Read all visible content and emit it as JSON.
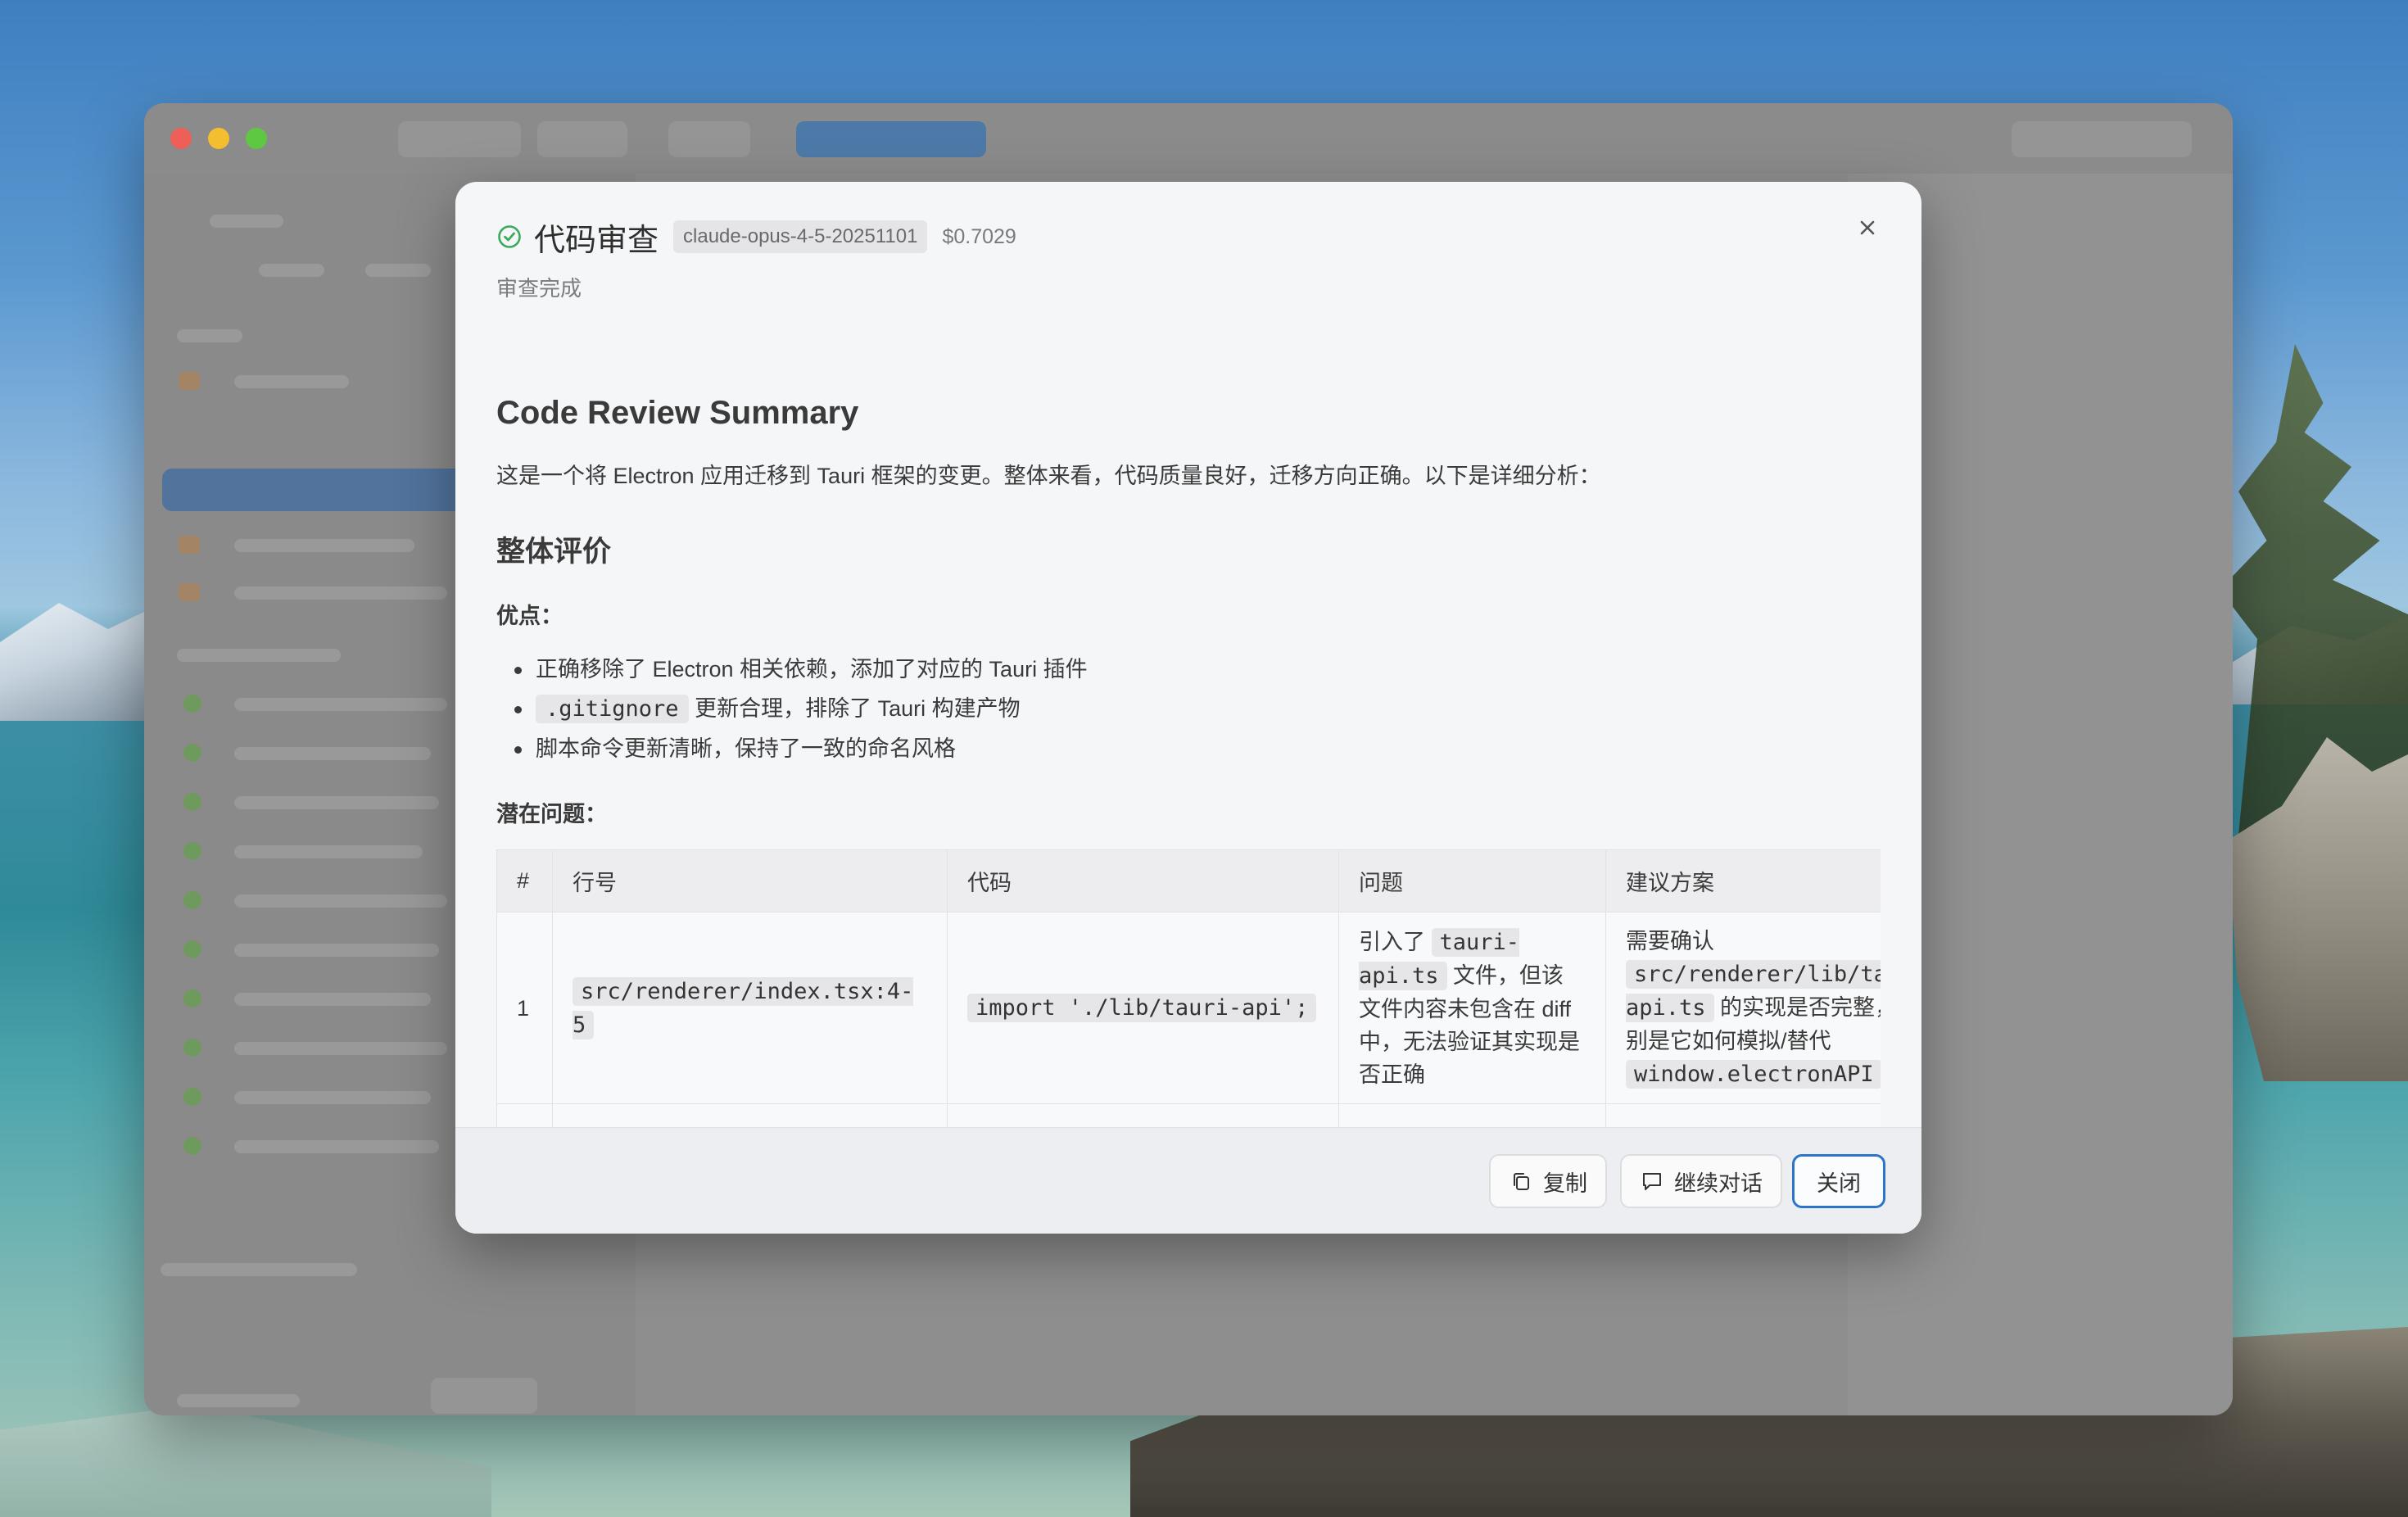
{
  "background": {
    "accent": "#2b74c8"
  },
  "modal": {
    "title": "代码审查",
    "model": "claude-opus-4-5-20251101",
    "cost": "$0.7029",
    "subtitle": "审查完成",
    "status_icon": "check-circle-icon",
    "status_color": "#3bab5b"
  },
  "content": {
    "h1": "Code Review Summary",
    "intro": "这是一个将 Electron 应用迁移到 Tauri 框架的变更。整体来看，代码质量良好，迁移方向正确。以下是详细分析：",
    "overall_heading": "整体评价",
    "pros_heading": "优点：",
    "pros": {
      "item1": "正确移除了 Electron 相关依赖，添加了对应的 Tauri 插件",
      "item2_code": ".gitignore",
      "item2_text": " 更新合理，排除了 Tauri 构建产物",
      "item3": "脚本命令更新清晰，保持了一致的命名风格"
    },
    "issues_heading": "潜在问题：",
    "table": {
      "headers": [
        "#",
        "行号",
        "代码",
        "问题",
        "建议方案"
      ],
      "row1": {
        "index": "1",
        "line": "src/renderer/index.tsx:4-5",
        "code": "import './lib/tauri-api';",
        "issue_prefix": "引入了 ",
        "issue_code": "tauri-api.ts",
        "issue_suffix": " 文件，但该文件内容未包含在 diff 中，无法验证其实现是否正确",
        "fix_prefix": "需要确认 ",
        "fix_code": "src/renderer/lib/tauri-api.ts",
        "fix_middle": " 的实现是否完整，特别是它如何模拟/替代 ",
        "fix_code2": "window.electronAPI"
      }
    }
  },
  "footer": {
    "copy_label": "复制",
    "continue_label": "继续对话",
    "close_label": "关闭"
  }
}
